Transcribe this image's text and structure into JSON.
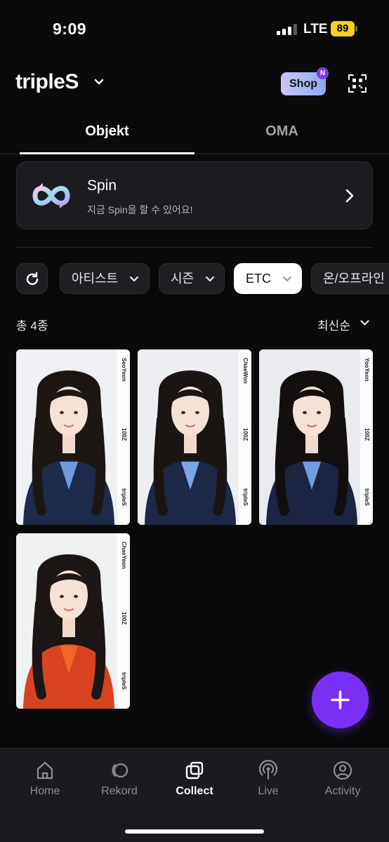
{
  "status_bar": {
    "time": "9:09",
    "network": "LTE",
    "battery": "89"
  },
  "header": {
    "brand": "tripleS",
    "shop_label": "Shop",
    "shop_badge": "N"
  },
  "tabs": [
    {
      "label": "Objekt",
      "active": true
    },
    {
      "label": "OMA",
      "active": false
    }
  ],
  "spin": {
    "title": "Spin",
    "subtitle": "지금 Spin을 할 수 있어요!"
  },
  "filters": {
    "chips": [
      "아티스트",
      "시즌",
      "ETC",
      "온/오프라인"
    ]
  },
  "list": {
    "count": "총 4종",
    "sort": "최신순"
  },
  "objekts": [
    {
      "member": "SeoYeon",
      "number": "100Z",
      "group": "tripleS",
      "hair": "#1d1714",
      "top": "#1e2a4a",
      "accent": "#6b9be0",
      "bg": "#eef0f3"
    },
    {
      "member": "ChaeWon",
      "number": "100Z",
      "group": "tripleS",
      "hair": "#1a1512",
      "top": "#1d2746",
      "accent": "#7aa6e6",
      "bg": "#eceef1"
    },
    {
      "member": "YooYeon",
      "number": "100Z",
      "group": "tripleS",
      "hair": "#120f0e",
      "top": "#1b2443",
      "accent": "#6f9de0",
      "bg": "#e9ebef"
    },
    {
      "member": "ChaeYeon",
      "number": "100Z",
      "group": "tripleS",
      "hair": "#1c1614",
      "top": "#d8441f",
      "accent": "#f0672e",
      "bg": "#eff0f2"
    }
  ],
  "bottom_nav": [
    {
      "label": "Home",
      "icon": "home-icon",
      "active": false
    },
    {
      "label": "Rekord",
      "icon": "rekord-icon",
      "active": false
    },
    {
      "label": "Collect",
      "icon": "collect-icon",
      "active": true
    },
    {
      "label": "Live",
      "icon": "live-icon",
      "active": false
    },
    {
      "label": "Activity",
      "icon": "activity-icon",
      "active": false
    }
  ],
  "colors": {
    "accent": "#7a2ff5",
    "shop_gradient_start": "#c9c4f7",
    "background": "#0a0a0b"
  }
}
